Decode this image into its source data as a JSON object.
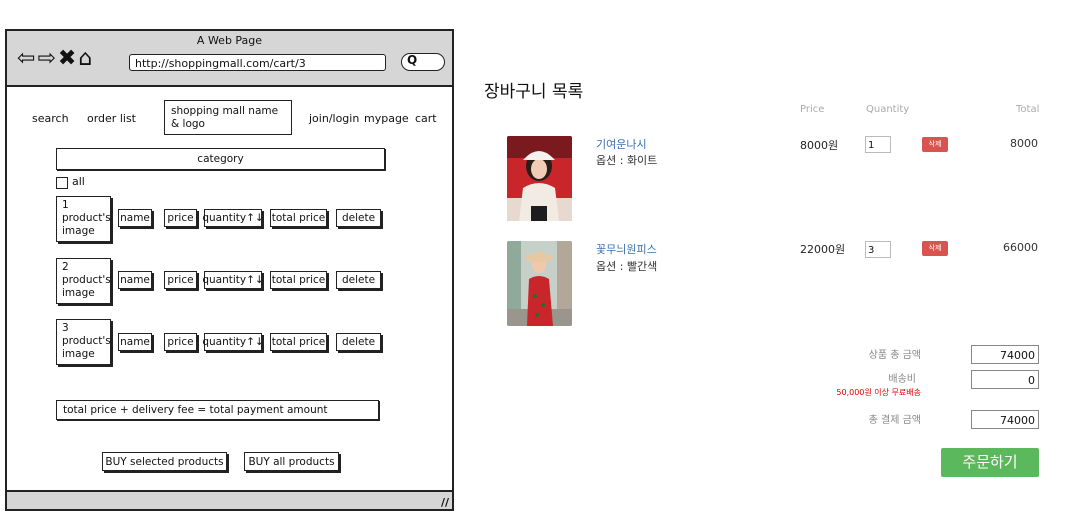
{
  "wireframe": {
    "window_title": "A Web Page",
    "url": "http://shoppingmall.com/cart/3",
    "nav": {
      "search": "search",
      "order_list": "order list",
      "logo_line1": "shopping mall name",
      "logo_line2": "& logo",
      "join_login": "join/login",
      "mypage": "mypage",
      "cart": "cart"
    },
    "category": "category",
    "all_label": "all",
    "rows": [
      {
        "num": "1",
        "img_line1": "product's",
        "img_line2": "image"
      },
      {
        "num": "2",
        "img_line1": "product's",
        "img_line2": "image"
      },
      {
        "num": "3",
        "img_line1": "product's",
        "img_line2": "image"
      }
    ],
    "cells": {
      "name": "name",
      "price": "price",
      "quantity": "quantity↑↓",
      "total_price": "total price",
      "delete": "delete"
    },
    "total_formula": "total price + delivery fee = total payment amount",
    "buy_selected": "BUY selected products",
    "buy_all": "BUY all products"
  },
  "cart": {
    "title": "장바구니 목록",
    "headers": {
      "price": "Price",
      "quantity": "Quantity",
      "total": "Total"
    },
    "items": [
      {
        "name": "기여운나시",
        "option": "옵션 : 화이트",
        "price": "8000원",
        "quantity": "1",
        "delete": "삭제",
        "total": "8000"
      },
      {
        "name": "꽃무늬원피스",
        "option": "옵션 : 빨간색",
        "price": "22000원",
        "quantity": "3",
        "delete": "삭제",
        "total": "66000"
      }
    ],
    "summary": {
      "subtotal_label": "상품 총 금액",
      "subtotal_value": "74000",
      "delivery_label": "배송비",
      "delivery_note": "50,000원 이상 무료배송",
      "delivery_value": "0",
      "grand_label": "총 결제 금액",
      "grand_value": "74000"
    },
    "order_button": "주문하기",
    "colors": {
      "delete": "#d9534f",
      "order": "#5cb85c",
      "link": "#3a6fb0"
    }
  }
}
